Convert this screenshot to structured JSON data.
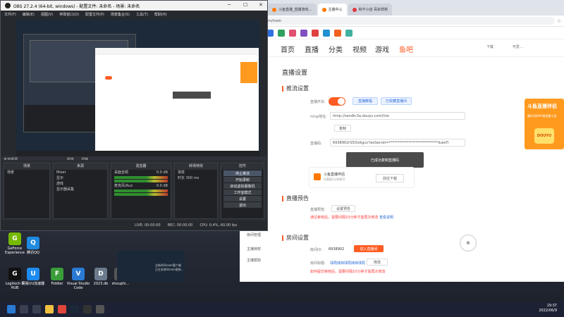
{
  "desktop": {
    "icons": [
      {
        "label": "GeForce Experience",
        "color": "#76b900",
        "glyph": "G"
      },
      {
        "label": "腾讯QQ",
        "color": "#1f8ae0",
        "glyph": "Q"
      },
      {
        "label": "Logitech G HUB",
        "color": "#111111",
        "glyph": "G"
      },
      {
        "label": "网易UU加速器",
        "color": "#1d8bf0",
        "glyph": "U"
      },
      {
        "label": "Fiddler",
        "color": "#3a9d3a",
        "glyph": "F"
      },
      {
        "label": "Visual Studio Code",
        "color": "#2a7ad4",
        "glyph": "V"
      },
      {
        "label": "2023.db",
        "color": "#6b7b8c",
        "glyph": "D"
      },
      {
        "label": "shouphi…",
        "color": "#555555",
        "glyph": "S"
      }
    ]
  },
  "obs": {
    "title": "OBS 27.2.4 (64-bit, windows) - 配置文件: 未命名 - 场景: 未命名",
    "menu": [
      "文件(F)",
      "编辑(E)",
      "视图(V)",
      "停靠窗口(D)",
      "配置文件(P)",
      "场景集合(S)",
      "工具(T)",
      "帮助(H)"
    ],
    "filter_bar": "未选择源",
    "filter_buttons": [
      "属性",
      "滤镜"
    ],
    "docks": {
      "scenes": {
        "title": "场景",
        "items": [
          "场景"
        ]
      },
      "sources": {
        "title": "来源",
        "items": [
          "Mixer",
          "显示",
          "游戏",
          "显示器采集"
        ]
      },
      "mixer": {
        "title": "混音器",
        "tracks": [
          {
            "name": "桌面音频",
            "level": "0.0 dB"
          },
          {
            "name": "麦克风/Aux",
            "level": "0.0 dB"
          }
        ]
      },
      "transitions": {
        "title": "转场特效",
        "type": "渐变",
        "duration_label": "时长",
        "duration": "300 ms"
      },
      "controls": {
        "title": "控件",
        "buttons": [
          "停止推流",
          "开始录制",
          "启动虚拟摄像机",
          "工作室模式",
          "设置",
          "退出"
        ]
      }
    },
    "status": {
      "live": "LIVE: 00:00:00",
      "rec": "REC: 00:00:00",
      "cpu": "CPU: 0.4%, 60.00 fps"
    }
  },
  "browser": {
    "tabs": [
      "斗鱼直播_直播游戏…",
      "主播中心",
      "和平小店·百余样新"
    ],
    "url": "...com/main",
    "nav": {
      "items": [
        "首页",
        "直播",
        "分类",
        "视频",
        "游戏",
        "鱼吧"
      ],
      "active": "直播",
      "download": "下载",
      "user": "可爱…"
    },
    "sidebar": [
      "房间管理",
      "主播特权",
      "主播帮助"
    ],
    "page": {
      "heading": "直播设置",
      "push": {
        "title": "推流设置",
        "switch_label": "直播开关:",
        "btn_tutorial": "直播教程",
        "btn_record": "已收藏直播间",
        "rtmp_label": "rtmp地址:",
        "rtmp_value": "rtmp://sendtc3a.douyu.com/live",
        "copy": "复制",
        "code_label": "直播码:",
        "code_value": "6938902rS5OxKguv?wsSecret=****************************&wsTi",
        "toast": "已成功复制直播码"
      },
      "promo": {
        "title": "斗鱼直播伴侣",
        "subtitle": "仅需要1分钟即可",
        "button": "前往下载"
      },
      "preview": {
        "title": "直播预告",
        "label": "直播预告:",
        "button": "设置预告",
        "notice": "通过审核后，需要间隔10分钟才能再次修改",
        "notice_link": "查看说明"
      },
      "room": {
        "title": "房间设置",
        "id_label": "房间ID:",
        "id_value": "6938902",
        "enter": "进入直播间",
        "name_label": "房间标题:",
        "name_value": "球局妹妹球局妹妹球局",
        "edit": "修改",
        "notice": "如何提交审核后，需要间隔10分钟才能再次修改"
      },
      "banner": {
        "title": "斗鱼直播伴侣",
        "subtitle": "最好用的PC端直播工具",
        "logo": "DOUYU"
      }
    }
  },
  "steam": {
    "line1": "全新的Steam客户端",
    "line2": "正在安装Steam更新..."
  },
  "taskbar": {
    "time": "19:37",
    "date": "2022/06/9"
  }
}
